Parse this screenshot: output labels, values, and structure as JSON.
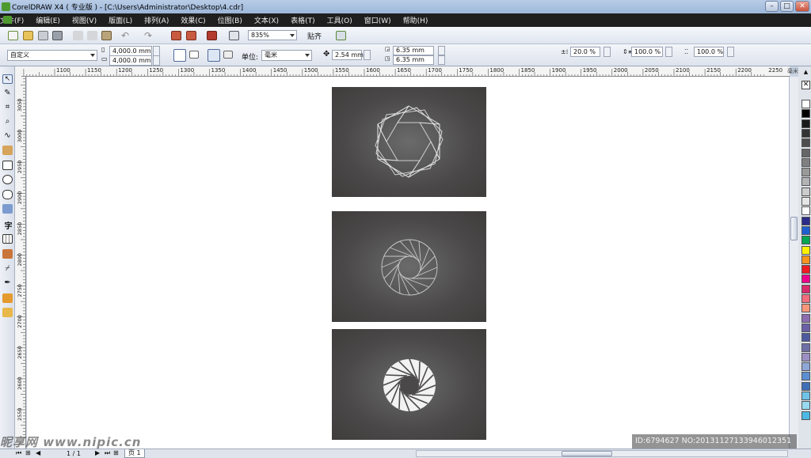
{
  "window": {
    "title": "CorelDRAW X4 ( 专业版 ) - [C:\\Users\\Administrator\\Desktop\\4.cdr]",
    "controls": [
      "–",
      "□",
      "✕"
    ]
  },
  "menu": [
    "文件(F)",
    "编辑(E)",
    "视图(V)",
    "版面(L)",
    "排列(A)",
    "效果(C)",
    "位图(B)",
    "文本(X)",
    "表格(T)",
    "工具(O)",
    "窗口(W)",
    "帮助(H)"
  ],
  "toolbar": {
    "zoom": "835%",
    "snap_label": "贴齐"
  },
  "property_bar": {
    "paper_preset": "自定义",
    "width": "4,000.0 mm",
    "height": "4,000.0 mm",
    "units_label": "单位:",
    "units_value": "毫米",
    "nudge": "2.54 mm",
    "dup_x": "6.35 mm",
    "dup_y": "6.35 mm",
    "pct1": "20.0 %",
    "pct2": "100.0 %",
    "pct3": "100.0 %"
  },
  "ruler": {
    "h_ticks": [
      "1100",
      "1150",
      "1200",
      "1250",
      "1300",
      "1350",
      "1400",
      "1450",
      "1500",
      "1550",
      "1600",
      "1650",
      "1700",
      "1750",
      "1800",
      "1850",
      "1900",
      "1950",
      "2000",
      "2050",
      "2100",
      "2150",
      "2200",
      "2250"
    ],
    "v_ticks": [
      "3050",
      "3000",
      "2950",
      "2900",
      "2850",
      "2800",
      "2750",
      "2700",
      "2650",
      "2600",
      "2550"
    ],
    "unit": "毫米"
  },
  "palette_colors": [
    "#ffffff",
    "#000000",
    "#1a1a1a",
    "#333333",
    "#4d4d4d",
    "#666666",
    "#808080",
    "#999999",
    "#b3b3b3",
    "#cccccc",
    "#e6e6e6",
    "#ffffff",
    "#2b2b8a",
    "#1f5fd1",
    "#00a651",
    "#fff200",
    "#f7941d",
    "#ed1c24",
    "#ec008c",
    "#d82b6b",
    "#f26d7d",
    "#f7977a",
    "#8b6db0",
    "#6b5fa8",
    "#4f59a0",
    "#6f6fa8",
    "#9b8fc4",
    "#8fa6d6",
    "#5b8fd1",
    "#3f6fb8",
    "#6fc3e8",
    "#98d8f0",
    "#4cb8e3"
  ],
  "status": {
    "page_counter": "1 / 1",
    "page_tab": "页 1"
  },
  "overlay": {
    "watermark": "昵享网 www.nipic.cn",
    "image_id": "ID:6794627 NO:20131127133946012351"
  }
}
